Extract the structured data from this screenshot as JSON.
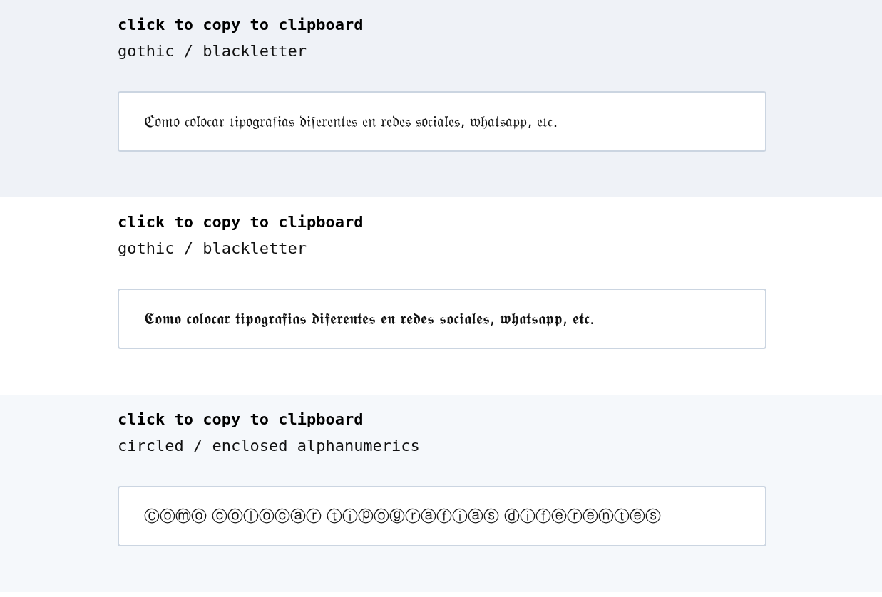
{
  "sections": [
    {
      "heading": "click to copy to clipboard",
      "style_name": "gothic / blackletter",
      "output": "ℭ𝔬𝔪𝔬 𝔠𝔬𝔩𝔬𝔠𝔞𝔯 𝔱𝔦𝔭𝔬𝔤𝔯𝔞𝔣𝔦𝔞𝔰 𝔡𝔦𝔣𝔢𝔯𝔢𝔫𝔱𝔢𝔰 𝔢𝔫 𝔯𝔢𝔡𝔢𝔰 𝔰𝔬𝔠𝔦𝔞𝔩𝔢𝔰, 𝔴𝔥𝔞𝔱𝔰𝔞𝔭𝔭, 𝔢𝔱𝔠."
    },
    {
      "heading": "click to copy to clipboard",
      "style_name": "gothic / blackletter",
      "output": "𝕮𝖔𝖒𝖔 𝖈𝖔𝖑𝖔𝖈𝖆𝖗 𝖙𝖎𝖕𝖔𝖌𝖗𝖆𝖋𝖎𝖆𝖘 𝖉𝖎𝖋𝖊𝖗𝖊𝖓𝖙𝖊𝖘 𝖊𝖓 𝖗𝖊𝖉𝖊𝖘 𝖘𝖔𝖈𝖎𝖆𝖑𝖊𝖘, 𝖜𝖍𝖆𝖙𝖘𝖆𝖕𝖕, 𝖊𝖙𝖈."
    },
    {
      "heading": "click to copy to clipboard",
      "style_name": "circled / enclosed alphanumerics",
      "output": "Ⓒⓞⓜⓞ ⓒⓞⓛⓞⓒⓐⓡ ⓣⓘⓟⓞⓖⓡⓐⓕⓘⓐⓢ ⓓⓘⓕⓔⓡⓔⓝⓣⓔⓢ"
    }
  ]
}
